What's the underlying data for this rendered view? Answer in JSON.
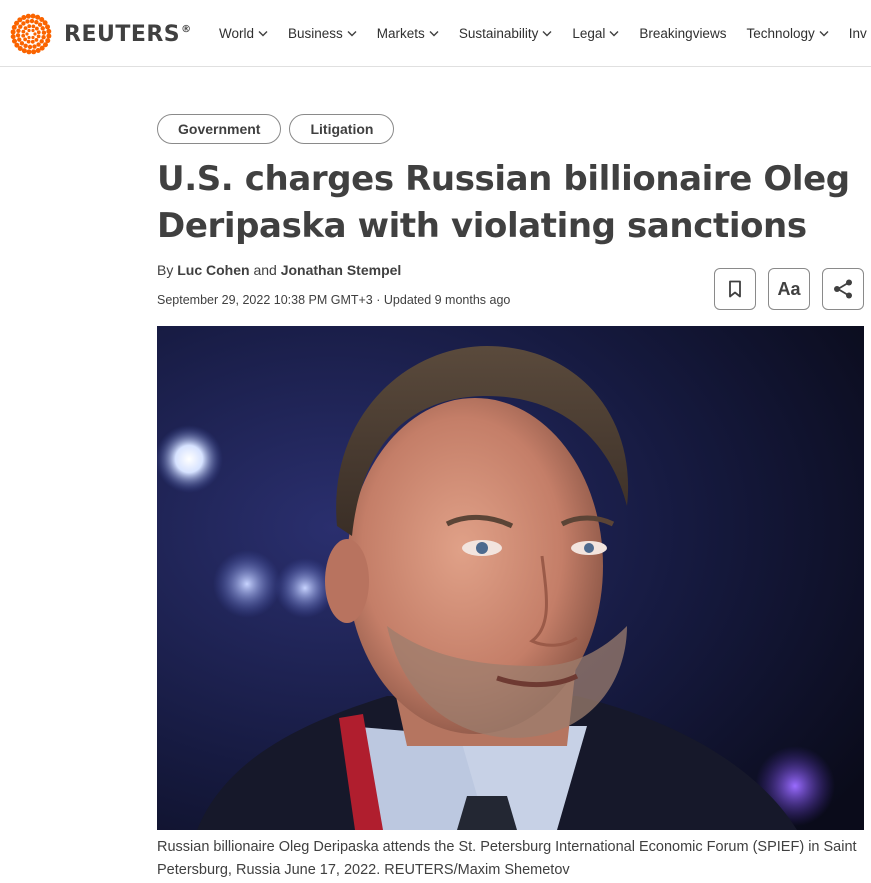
{
  "brand": {
    "name": "REUTERS",
    "registered": "®"
  },
  "nav": {
    "items": [
      {
        "label": "World",
        "has_dropdown": true
      },
      {
        "label": "Business",
        "has_dropdown": true
      },
      {
        "label": "Markets",
        "has_dropdown": true
      },
      {
        "label": "Sustainability",
        "has_dropdown": true
      },
      {
        "label": "Legal",
        "has_dropdown": true
      },
      {
        "label": "Breakingviews",
        "has_dropdown": false
      },
      {
        "label": "Technology",
        "has_dropdown": true
      },
      {
        "label": "Inv",
        "has_dropdown": false
      }
    ]
  },
  "article": {
    "tags": [
      "Government",
      "Litigation"
    ],
    "headline": "U.S. charges Russian billionaire Oleg Deripaska with violating sanctions",
    "byline": {
      "prefix": "By",
      "author_1": "Luc Cohen",
      "connector": "and",
      "author_2": "Jonathan Stempel"
    },
    "dateline": {
      "published": "September 29, 2022 10:38 PM GMT+3",
      "separator": "·",
      "updated": "Updated 9 months ago"
    },
    "actions": {
      "bookmark_icon": "bookmark-icon",
      "text_size_label": "Aa",
      "share_icon": "share-icon"
    },
    "caption": "Russian billionaire Oleg Deripaska attends the St. Petersburg International Economic Forum (SPIEF) in Saint Petersburg, Russia June 17, 2022. REUTERS/Maxim Shemetov"
  },
  "colors": {
    "brand_orange": "#fa6400",
    "text": "#404040",
    "border": "#8a8a8a",
    "photo_background": "#151a3a"
  }
}
